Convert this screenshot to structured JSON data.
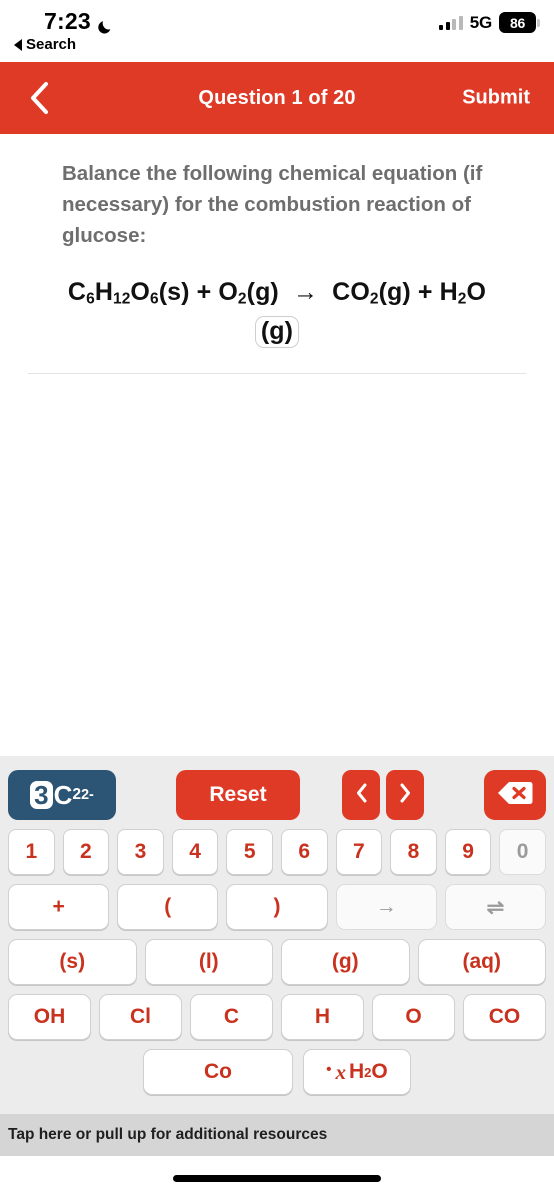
{
  "status_bar": {
    "time": "7:23",
    "moon_icon": "crescent-moon-icon",
    "search_label": "Search",
    "signal_icon": "cellular-bars-icon",
    "network": "5G",
    "battery_percent": "86"
  },
  "nav": {
    "back_icon": "chevron-left-icon",
    "title": "Question 1 of 20",
    "submit_label": "Submit"
  },
  "question": {
    "prompt": "Balance the following chemical equation (if necessary) for the combustion reaction of glucose:",
    "equation_line1": "C₆H₁₂O₆(s) + O₂(g) → CO₂(g) + H₂O",
    "equation_parts": [
      {
        "text": "C",
        "sub": "6"
      },
      {
        "text": "H",
        "sub": "12"
      },
      {
        "text": "O",
        "sub": "6"
      },
      {
        "text": "(s)",
        "sub": ""
      },
      {
        "text": "+",
        "sub": ""
      },
      {
        "text": "O",
        "sub": "2"
      },
      {
        "text": "(g)",
        "sub": ""
      },
      {
        "text": "→",
        "sub": ""
      },
      {
        "text": "CO",
        "sub": "2"
      },
      {
        "text": "(g)",
        "sub": ""
      },
      {
        "text": "+",
        "sub": ""
      },
      {
        "text": "H",
        "sub": "2"
      },
      {
        "text": "O",
        "sub": ""
      }
    ],
    "selected_token": "(g)"
  },
  "keyboard": {
    "mode_badge": {
      "coefficient": "3",
      "element": "C",
      "subscript": "2",
      "charge": "2-"
    },
    "reset_label": "Reset",
    "prev_icon": "chevron-left-icon",
    "next_icon": "chevron-right-icon",
    "delete_icon": "backspace-delete-icon",
    "number_row": [
      {
        "label": "1",
        "enabled": true
      },
      {
        "label": "2",
        "enabled": true
      },
      {
        "label": "3",
        "enabled": true
      },
      {
        "label": "4",
        "enabled": true
      },
      {
        "label": "5",
        "enabled": true
      },
      {
        "label": "6",
        "enabled": true
      },
      {
        "label": "7",
        "enabled": true
      },
      {
        "label": "8",
        "enabled": true
      },
      {
        "label": "9",
        "enabled": true
      },
      {
        "label": "0",
        "enabled": false
      }
    ],
    "symbol_row": [
      {
        "label": "+",
        "enabled": true
      },
      {
        "label": "(",
        "enabled": true
      },
      {
        "label": ")",
        "enabled": true
      },
      {
        "label": "→",
        "enabled": false
      },
      {
        "label": "⇌",
        "enabled": false
      }
    ],
    "state_row": [
      {
        "label": "(s)",
        "enabled": true
      },
      {
        "label": "(l)",
        "enabled": true
      },
      {
        "label": "(g)",
        "enabled": true
      },
      {
        "label": "(aq)",
        "enabled": true
      }
    ],
    "element_row": [
      {
        "label": "OH",
        "enabled": true
      },
      {
        "label": "Cl",
        "enabled": true
      },
      {
        "label": "C",
        "enabled": true
      },
      {
        "label": "H",
        "enabled": true
      },
      {
        "label": "O",
        "enabled": true
      },
      {
        "label": "CO",
        "enabled": true
      }
    ],
    "last_row": {
      "cobalt": "Co",
      "hydrate_dot": "•",
      "hydrate_var": "x",
      "hydrate_formula_main": "H",
      "hydrate_formula_sub": "2",
      "hydrate_formula_tail": "O"
    }
  },
  "footer": {
    "resources_label": "Tap here or pull up for additional resources",
    "home_indicator": "home-indicator"
  },
  "colors": {
    "brand_red": "#DE3A25",
    "key_red": "#C8321E",
    "badge_blue": "#2C5474",
    "keyboard_bg": "#ECECEC",
    "footer_bg": "#D5D5D5",
    "prompt_gray": "#6E6E6E"
  }
}
